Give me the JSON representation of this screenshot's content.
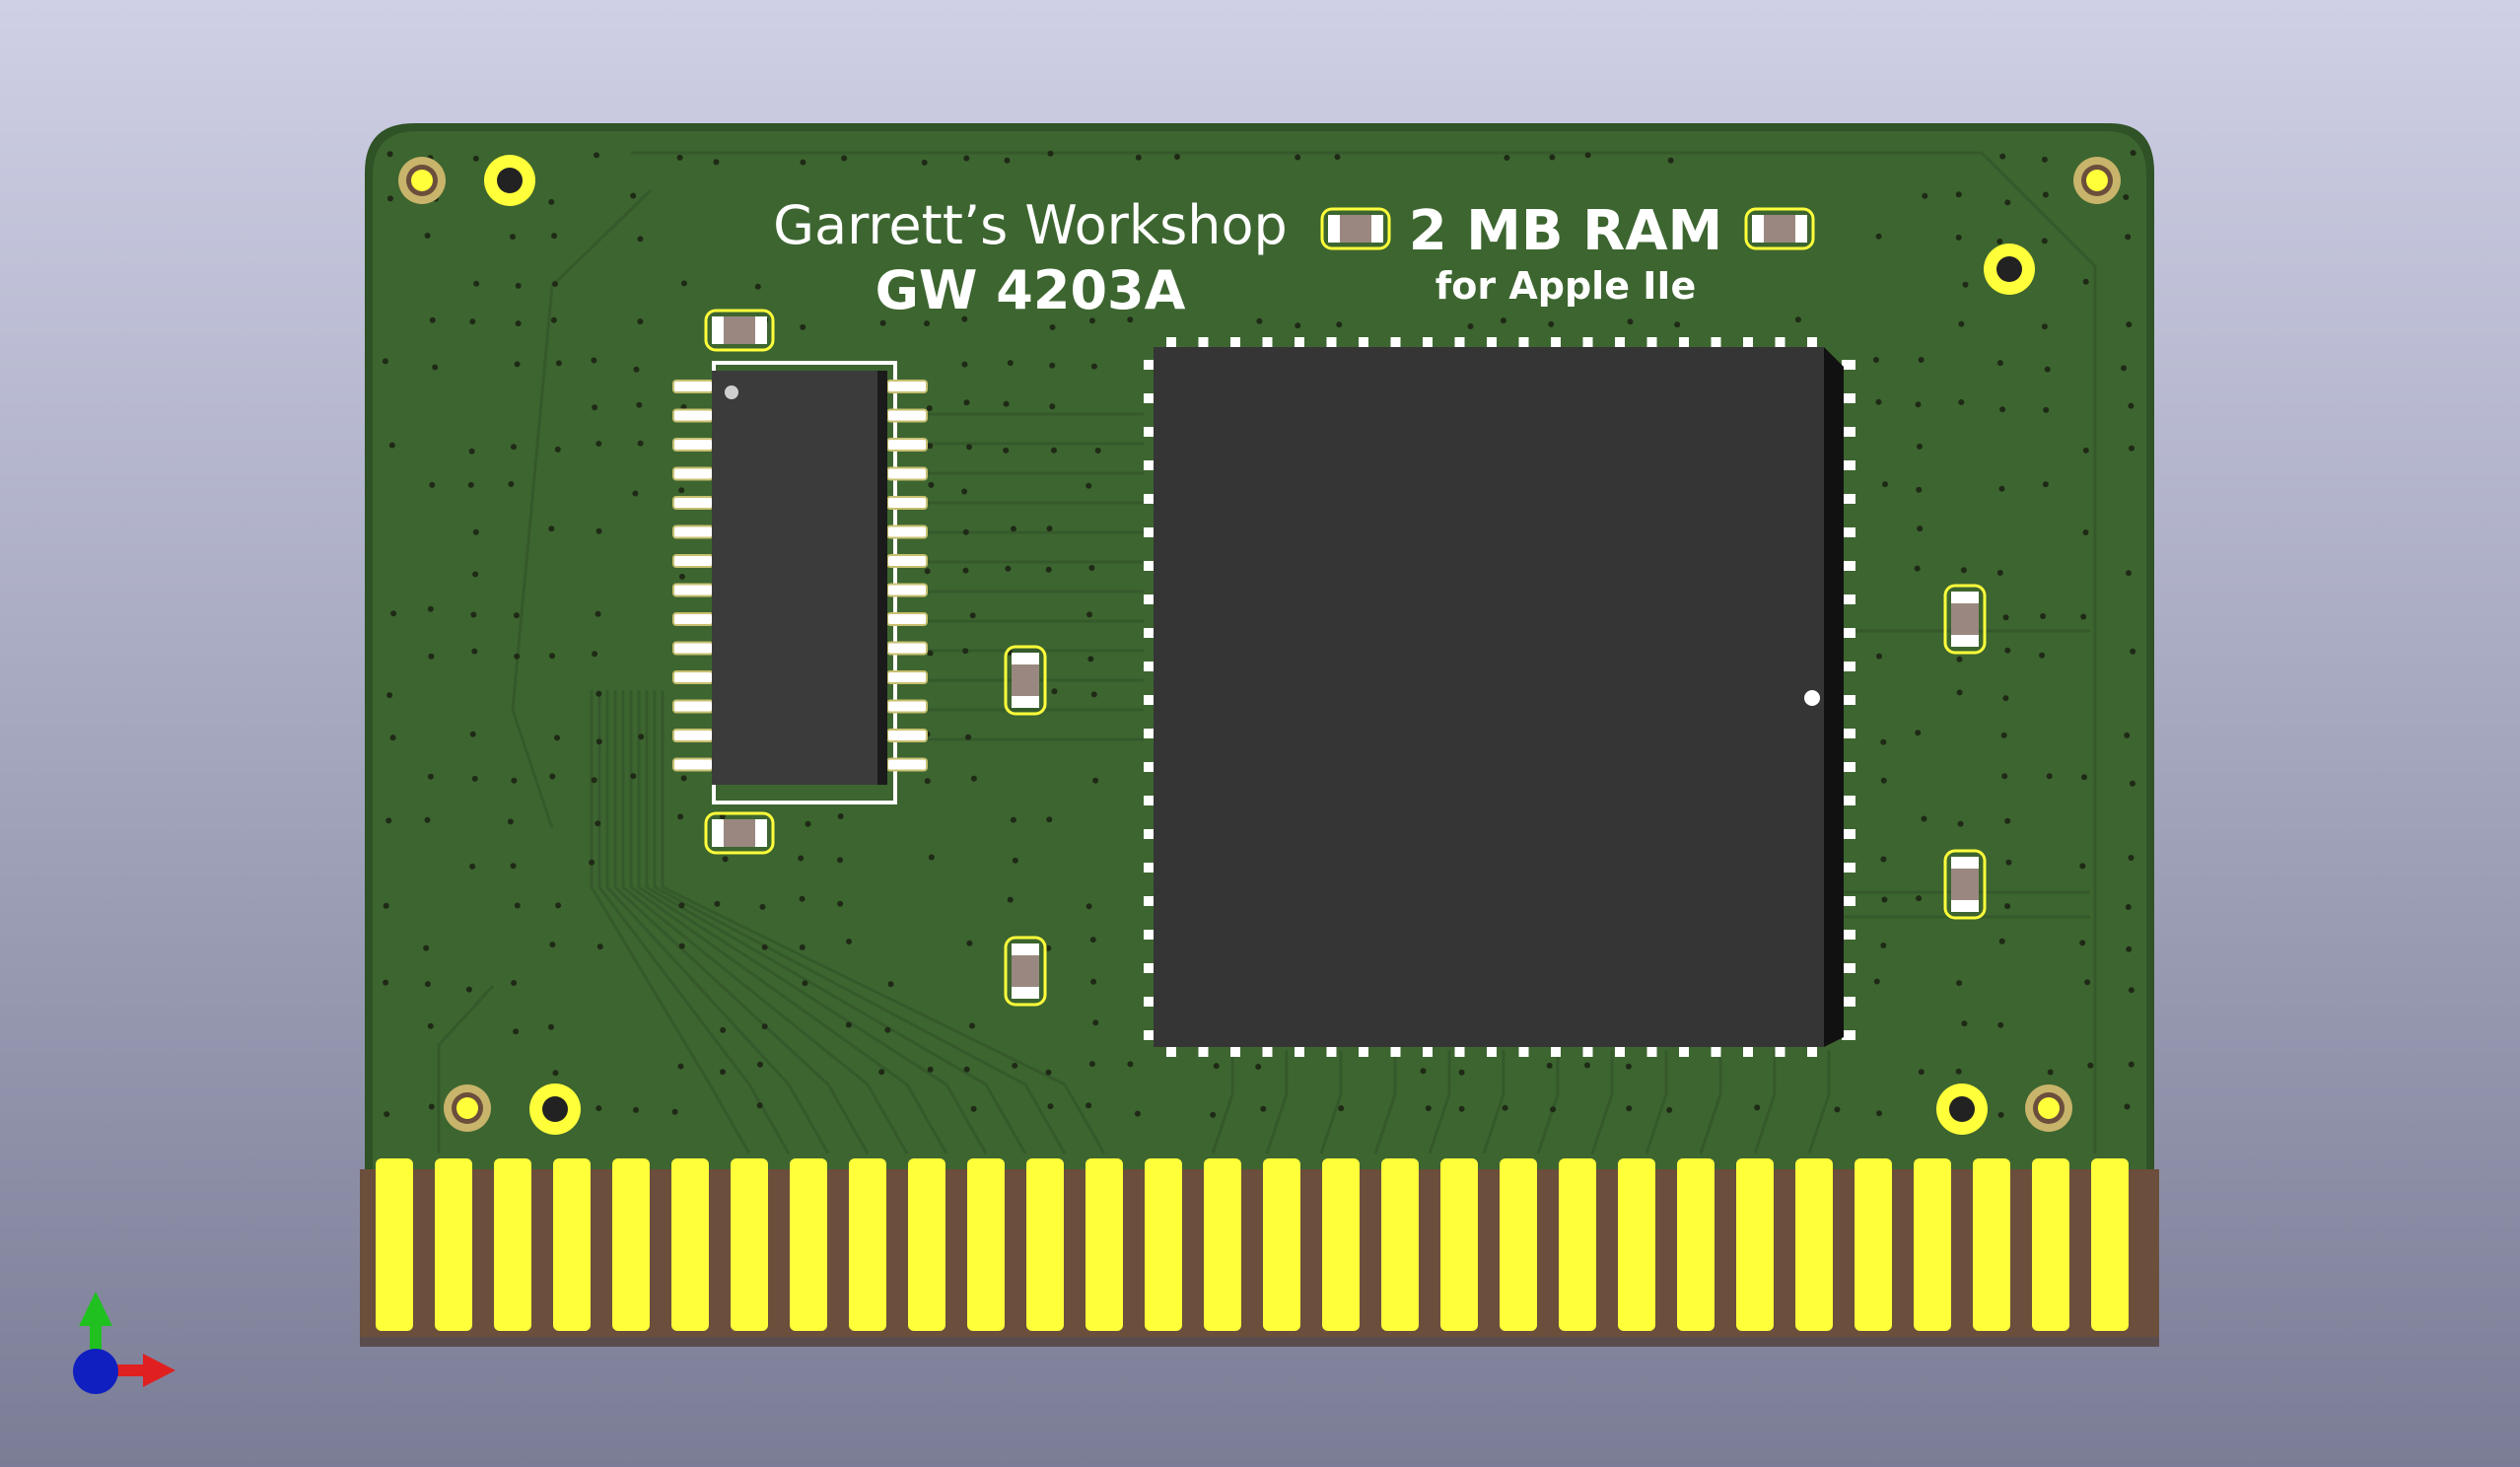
{
  "viewer": {
    "background_top": "#cfd0e6",
    "background_bottom": "#7b7d96"
  },
  "board": {
    "soldermask_color": "#3d6530",
    "copper_finish_color": "#ffff3a",
    "substrate_color": "#6b4e3c",
    "silkscreen_color": "#ffffff",
    "silkscreen": {
      "company": "Garrett’s Workshop",
      "part_number": "GW 4203A",
      "capacity": "2 MB RAM",
      "target": "for Apple IIe"
    },
    "edge_connector_fingers": 30
  },
  "components": {
    "sram_chip_color": "#3b3b3b",
    "cpld_chip_color": "#353535",
    "cpld_pins_per_side": 21,
    "sram_pins_per_side": 14
  },
  "axis_gizmo": {
    "x_axis_color": "#e02020",
    "y_axis_color": "#20c020",
    "z_axis_color": "#1020c0"
  }
}
